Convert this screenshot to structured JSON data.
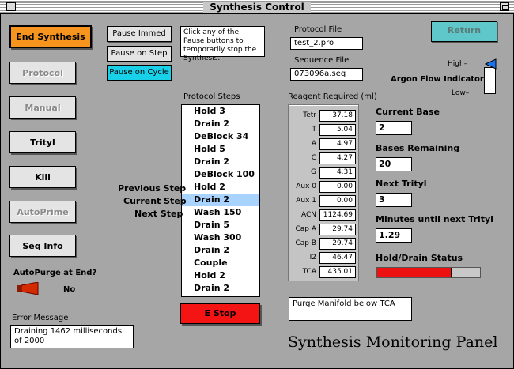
{
  "window": {
    "title": "Synthesis Control"
  },
  "buttons": {
    "end_synthesis": "End Synthesis",
    "protocol": "Protocol",
    "manual": "Manual",
    "trityl": "Trityl",
    "kill": "Kill",
    "autoprime": "AutoPrime",
    "seq_info": "Seq Info",
    "pause_immed": "Pause Immed",
    "pause_on_step": "Pause on Step",
    "pause_on_cycle": "Pause on Cycle",
    "return": "Return",
    "estop": "E Stop"
  },
  "pause_help": "Click any of the Pause buttons to temporarily stop the Synthesis.",
  "protocol_file": {
    "label": "Protocol File",
    "value": "test_2.pro"
  },
  "sequence_file": {
    "label": "Sequence File",
    "value": "073096a.seq"
  },
  "argon": {
    "label": "Argon Flow Indicator",
    "high": "High",
    "low": "Low",
    "level": 1.0
  },
  "protocol_steps": {
    "label": "Protocol Steps",
    "items": [
      "Hold 3",
      "Drain 2",
      "DeBlock 34",
      "Hold 5",
      "Drain 2",
      "DeBlock 100",
      "Hold 2",
      "Drain 2",
      "Wash 150",
      "Drain 5",
      "Wash 300",
      "Drain 2",
      "Couple",
      "Hold 2",
      "Drain 2"
    ],
    "selected_index": 7,
    "previous_step": "Previous Step",
    "current_step": "Current Step",
    "next_step": "Next Step"
  },
  "reagents": {
    "label": "Reagent Required (ml)",
    "rows": [
      {
        "name": "Tetr",
        "value": "37.18"
      },
      {
        "name": "T",
        "value": "5.04"
      },
      {
        "name": "A",
        "value": "4.97"
      },
      {
        "name": "C",
        "value": "4.27"
      },
      {
        "name": "G",
        "value": "4.31"
      },
      {
        "name": "Aux 0",
        "value": "0.00"
      },
      {
        "name": "Aux 1",
        "value": "0.00"
      },
      {
        "name": "ACN",
        "value": "1124.69"
      },
      {
        "name": "Cap A",
        "value": "29.74"
      },
      {
        "name": "Cap B",
        "value": "29.74"
      },
      {
        "name": "I2",
        "value": "46.47"
      },
      {
        "name": "TCA",
        "value": "435.01"
      }
    ]
  },
  "status": {
    "current_base": {
      "label": "Current Base",
      "value": "2"
    },
    "bases_remaining": {
      "label": "Bases Remaining",
      "value": "20"
    },
    "next_trityl": {
      "label": "Next Trityl",
      "value": "3"
    },
    "minutes_until": {
      "label": "Minutes until next Trityl",
      "value": "1.29"
    },
    "hold_drain": {
      "label": "Hold/Drain Status",
      "progress": 0.73
    }
  },
  "autopurge": {
    "label": "AutoPurge at End?",
    "value": "No"
  },
  "error": {
    "label": "Error Message",
    "value": "Draining 1462 milliseconds of 2000"
  },
  "message_box": "Purge Manifold below TCA",
  "panel_title": "Synthesis Monitoring Panel",
  "colors": {
    "end_synthesis": "#f7941d",
    "pause_on_cycle": "#18d0e8",
    "return": "#5fc7c9",
    "estop": "#f41414",
    "selected": "#a9d3ff",
    "progress": "#ee1111"
  }
}
